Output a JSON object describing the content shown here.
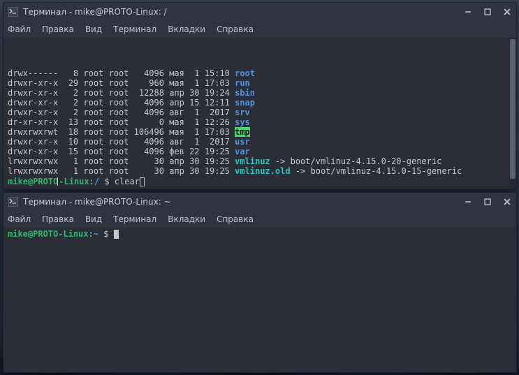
{
  "windows": {
    "top": {
      "title": "Терминал - mike@PROTO-Linux: /",
      "menus": [
        "Файл",
        "Правка",
        "Вид",
        "Терминал",
        "Вкладки",
        "Справка"
      ],
      "prompt": {
        "user": "mike",
        "at": "@",
        "host": "PROTO-Linux",
        "colon": ":",
        "path": "/",
        "sep": " $ ",
        "cmd": "clear"
      },
      "entries": [
        {
          "perm": "drwx------",
          "lnk": "8",
          "own": "root",
          "grp": "root",
          "size": "4096",
          "mon": "мая",
          "day": "1",
          "time": "15:10",
          "name": "root",
          "cls": "c-blue"
        },
        {
          "perm": "drwxr-xr-x",
          "lnk": "29",
          "own": "root",
          "grp": "root",
          "size": "960",
          "mon": "мая",
          "day": "1",
          "time": "17:03",
          "name": "run",
          "cls": "c-blue"
        },
        {
          "perm": "drwxr-xr-x",
          "lnk": "2",
          "own": "root",
          "grp": "root",
          "size": "12288",
          "mon": "апр",
          "day": "30",
          "time": "19:24",
          "name": "sbin",
          "cls": "c-blue"
        },
        {
          "perm": "drwxr-xr-x",
          "lnk": "2",
          "own": "root",
          "grp": "root",
          "size": "4096",
          "mon": "апр",
          "day": "15",
          "time": "12:11",
          "name": "snap",
          "cls": "c-blue"
        },
        {
          "perm": "drwxr-xr-x",
          "lnk": "2",
          "own": "root",
          "grp": "root",
          "size": "4096",
          "mon": "авг",
          "day": "1",
          "time": "2017",
          "name": "srv",
          "cls": "c-blue"
        },
        {
          "perm": "dr-xr-xr-x",
          "lnk": "13",
          "own": "root",
          "grp": "root",
          "size": "0",
          "mon": "мая",
          "day": "1",
          "time": "12:26",
          "name": "sys",
          "cls": "c-blue"
        },
        {
          "perm": "drwxrwxrwt",
          "lnk": "18",
          "own": "root",
          "grp": "root",
          "size": "106496",
          "mon": "мая",
          "day": "1",
          "time": "17:03",
          "name": "tmp",
          "cls": "c-tmp"
        },
        {
          "perm": "drwxr-xr-x",
          "lnk": "10",
          "own": "root",
          "grp": "root",
          "size": "4096",
          "mon": "авг",
          "day": "1",
          "time": "2017",
          "name": "usr",
          "cls": "c-blue"
        },
        {
          "perm": "drwxr-xr-x",
          "lnk": "15",
          "own": "root",
          "grp": "root",
          "size": "4096",
          "mon": "фев",
          "day": "22",
          "time": "19:25",
          "name": "var",
          "cls": "c-blue"
        },
        {
          "perm": "lrwxrwxrwx",
          "lnk": "1",
          "own": "root",
          "grp": "root",
          "size": "30",
          "mon": "апр",
          "day": "30",
          "time": "19:25",
          "name": "vmlinuz",
          "cls": "c-cyan",
          "target": "boot/vmlinuz-4.15.0-20-generic"
        },
        {
          "perm": "lrwxrwxrwx",
          "lnk": "1",
          "own": "root",
          "grp": "root",
          "size": "30",
          "mon": "апр",
          "day": "30",
          "time": "19:25",
          "name": "vmlinuz.old",
          "cls": "c-cyan",
          "target": "boot/vmlinuz-4.15.0-15-generic"
        }
      ]
    },
    "bottom": {
      "title": "Терминал - mike@PROTO-Linux: ~",
      "menus": [
        "Файл",
        "Правка",
        "Вид",
        "Терминал",
        "Вкладки",
        "Справка"
      ],
      "prompt": {
        "user": "mike",
        "at": "@",
        "host": "PROTO-Linux",
        "colon": ":",
        "path": "~",
        "sep": " $ ",
        "cmd": ""
      }
    }
  },
  "arrow": " -> "
}
